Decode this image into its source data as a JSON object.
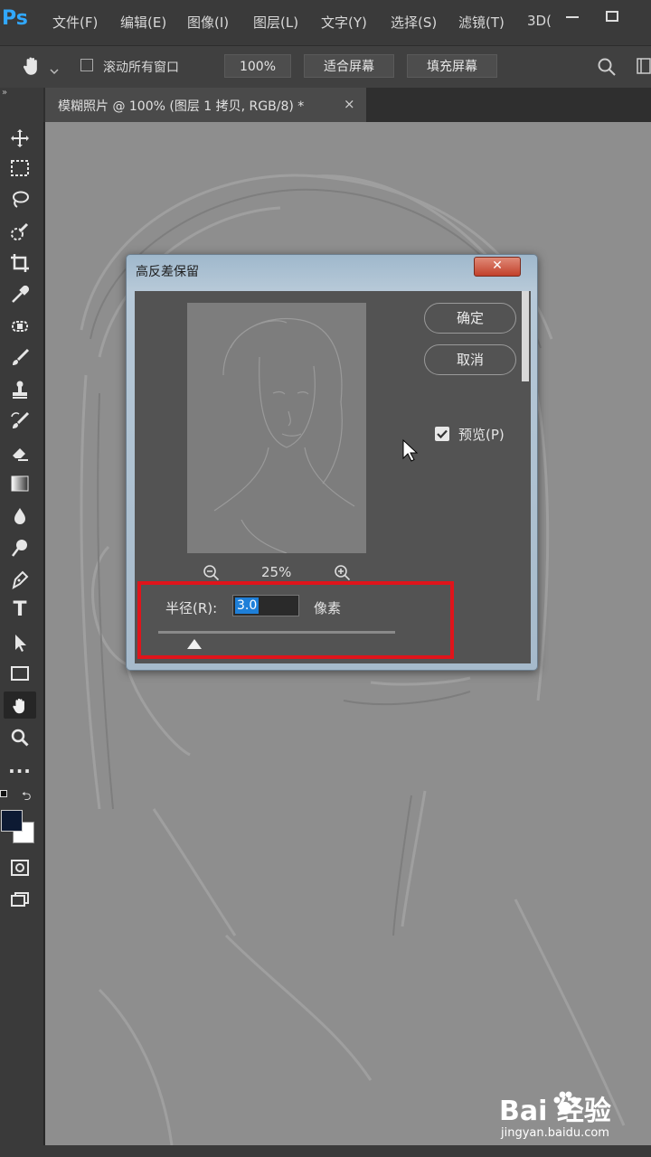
{
  "app": {
    "logo": "Ps"
  },
  "menu": [
    "文件(F)",
    "编辑(E)",
    "图像(I)",
    "图层(L)",
    "文字(Y)",
    "选择(S)",
    "滤镜(T)",
    "3D("
  ],
  "options": {
    "scroll_all_windows": "滚动所有窗口",
    "zoom": "100%",
    "fit_screen": "适合屏幕",
    "fill_screen": "填充屏幕"
  },
  "document_tab": {
    "title": "模糊照片 @ 100% (图层 1 拷贝, RGB/8) *",
    "close": "×"
  },
  "tools": [
    "move-icon",
    "marquee-icon",
    "lasso-icon",
    "quick-select-icon",
    "crop-icon",
    "eyedropper-icon",
    "healing-brush-icon",
    "brush-icon",
    "stamp-icon",
    "history-brush-icon",
    "eraser-icon",
    "gradient-icon",
    "blur-icon",
    "dodge-icon",
    "pen-icon",
    "type-icon",
    "path-select-icon",
    "rectangle-icon",
    "hand-icon",
    "zoom-icon",
    "more-icon"
  ],
  "toolbar": {
    "type_tool": "T",
    "more": "..."
  },
  "dialog": {
    "title": "高反差保留",
    "close": "✕",
    "ok": "确定",
    "cancel": "取消",
    "preview_label": "预览(P)",
    "preview_checked": true,
    "zoom_level": "25%",
    "radius_label": "半径(R):",
    "radius_value": "3.0",
    "radius_unit": "像素"
  },
  "watermark": {
    "brand": "Bai  经验",
    "url": "jingyan.baidu.com"
  },
  "colors": {
    "foreground": "#0d1a33",
    "background": "#ffffff",
    "accent": "#31a8ff",
    "highlight": "#e0141b"
  }
}
